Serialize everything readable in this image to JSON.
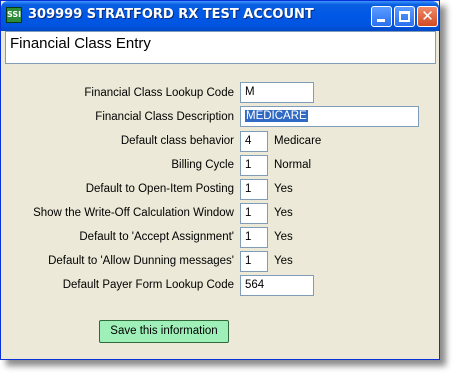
{
  "window": {
    "title": "309999 STRATFORD RX TEST ACCOUNT",
    "app_icon_text": "SSI",
    "close_glyph": "✕"
  },
  "header": {
    "title": "Financial Class Entry"
  },
  "form": {
    "lookup_code": {
      "label": "Financial Class Lookup Code",
      "value": "M"
    },
    "description": {
      "label": "Financial Class Description",
      "value": "MEDICARE"
    },
    "default_behavior": {
      "label": "Default class behavior",
      "value": "4",
      "meaning": "Medicare"
    },
    "billing_cycle": {
      "label": "Billing Cycle",
      "value": "1",
      "meaning": "Normal"
    },
    "open_item": {
      "label": "Default to Open-Item Posting",
      "value": "1",
      "meaning": "Yes"
    },
    "write_off": {
      "label": "Show the Write-Off Calculation Window",
      "value": "1",
      "meaning": "Yes"
    },
    "accept_assignment": {
      "label": "Default to 'Accept Assignment'",
      "value": "1",
      "meaning": "Yes"
    },
    "allow_dunning": {
      "label": "Default to 'Allow Dunning messages'",
      "value": "1",
      "meaning": "Yes"
    },
    "payer_form": {
      "label": "Default Payer Form Lookup Code",
      "value": "564"
    }
  },
  "actions": {
    "save_label": "Save this information"
  },
  "colors": {
    "titlebar": "#0058e6",
    "save_button": "#9ff0b8",
    "window_bg": "#ECE9D8",
    "selection": "#316ac5"
  }
}
